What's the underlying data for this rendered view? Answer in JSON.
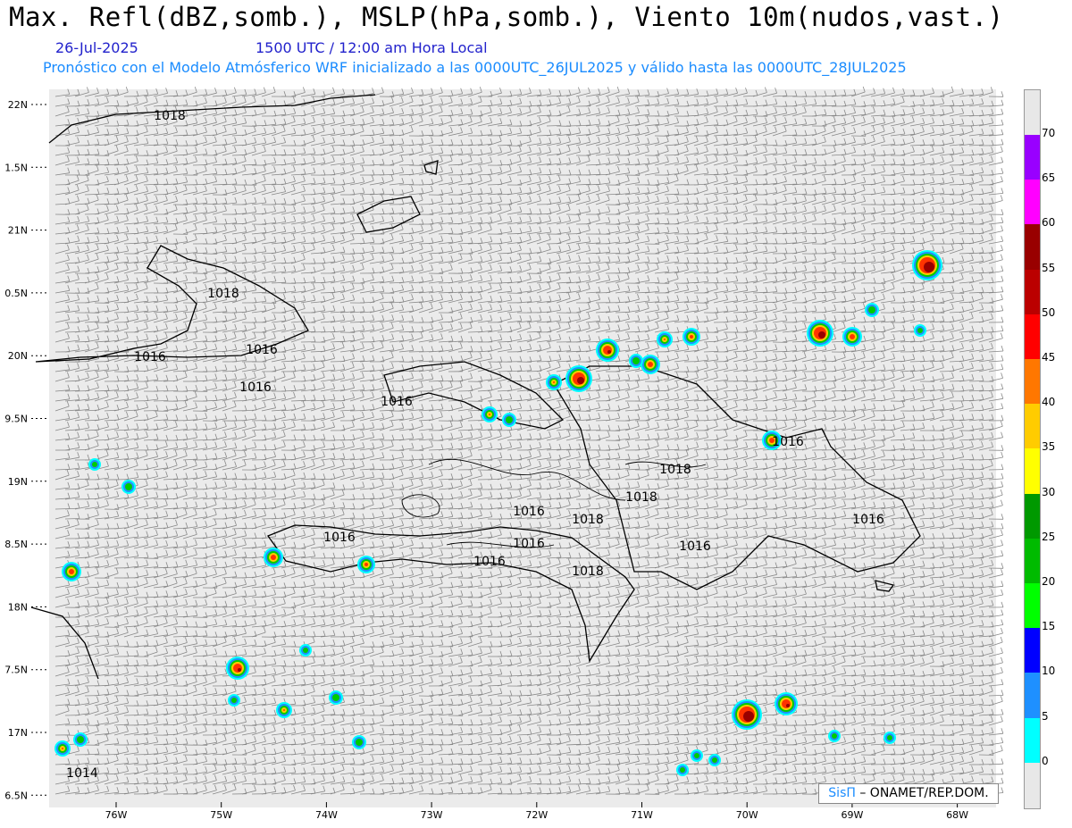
{
  "title": "Max. Refl(dBZ,somb.), MSLP(hPa,somb.), Viento 10m(nudos,vast.)",
  "date": "26-Jul-2025",
  "time": "1500 UTC / 12:00 am Hora Local",
  "subtitle": "Pronóstico con el Modelo Atmósferico WRF inicializado a las 0000UTC_26JUL2025 y válido hasta las  0000UTC_28JUL2025",
  "lat_labels": [
    "22N",
    "1.5N",
    "21N",
    "0.5N",
    "20N",
    "9.5N",
    "19N",
    "8.5N",
    "18N",
    "7.5N",
    "17N",
    "6.5N"
  ],
  "lon_labels": [
    "76W",
    "75W",
    "74W",
    "73W",
    "72W",
    "71W",
    "70W",
    "69W",
    "68W"
  ],
  "isobar_labels": [
    "1018",
    "1018",
    "1016",
    "1016",
    "1016",
    "1016",
    "1016",
    "1018",
    "1018",
    "1016",
    "1018",
    "1016",
    "1016",
    "1016",
    "1016",
    "1018",
    "1016",
    "1014"
  ],
  "colorbar": {
    "ticks": [
      "70",
      "65",
      "60",
      "55",
      "50",
      "45",
      "40",
      "35",
      "30",
      "25",
      "20",
      "15",
      "10",
      "5",
      "0"
    ],
    "colors": [
      "#9900ff",
      "#ff00ff",
      "#990000",
      "#bb0000",
      "#ff0000",
      "#ff7700",
      "#ffcc00",
      "#ffff00",
      "#009900",
      "#00bb00",
      "#00ff00",
      "#0000ff",
      "#1e90ff",
      "#00ffff"
    ]
  },
  "credit": {
    "logo": "SisΠ",
    "text": "–  ONAMET/REP.DOM."
  },
  "colors": {
    "land_outline": "#000",
    "isobar": "#000",
    "wind_barb": "#888",
    "background": "#ebebeb"
  }
}
